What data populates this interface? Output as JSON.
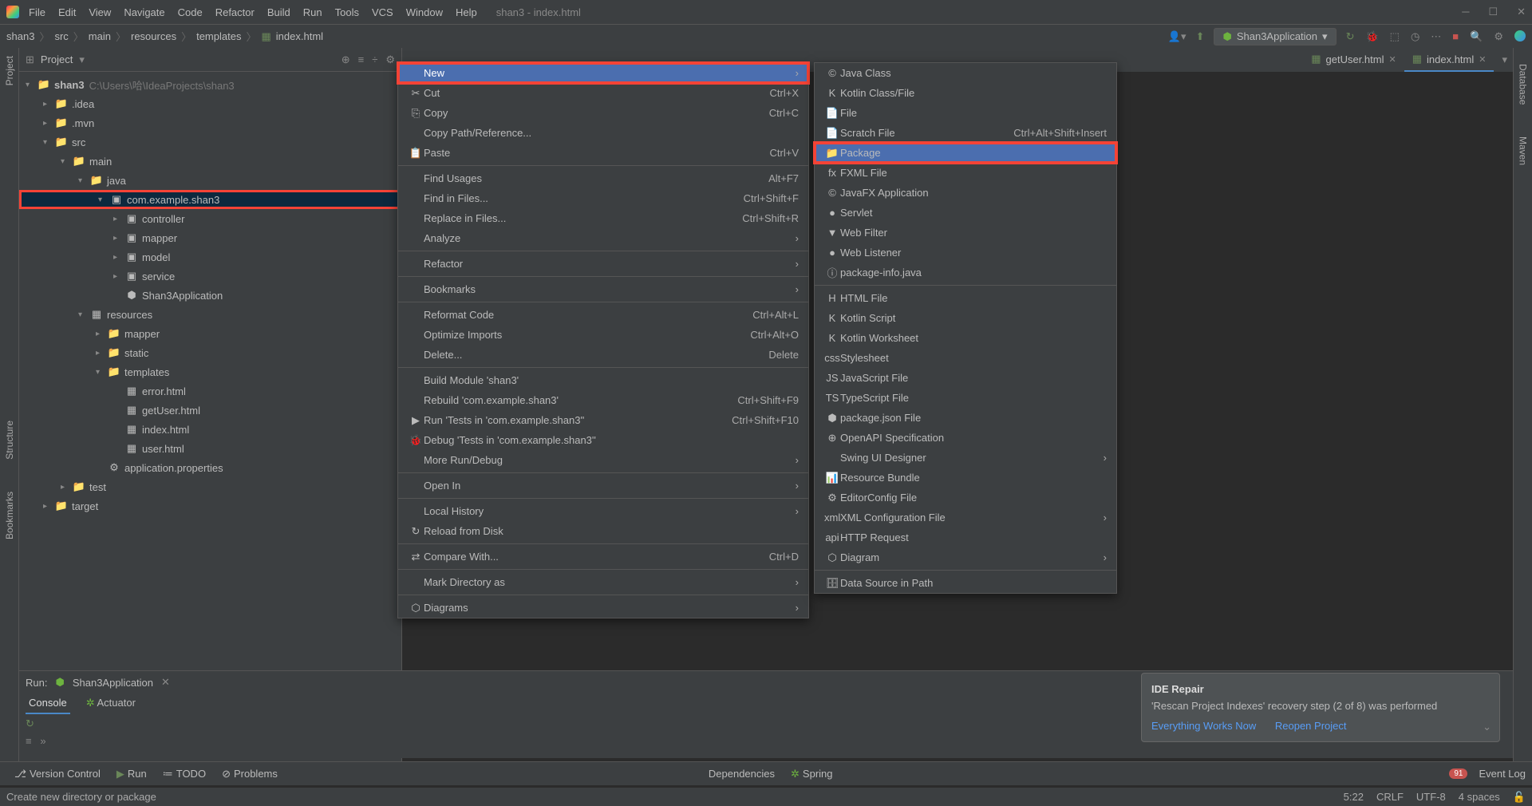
{
  "window": {
    "title": "shan3 - index.html"
  },
  "menubar": [
    "File",
    "Edit",
    "View",
    "Navigate",
    "Code",
    "Refactor",
    "Build",
    "Run",
    "Tools",
    "VCS",
    "Window",
    "Help"
  ],
  "breadcrumb": [
    "shan3",
    "src",
    "main",
    "resources",
    "templates",
    "index.html"
  ],
  "run_config": "Shan3Application",
  "project": {
    "label": "Project",
    "root": {
      "name": "shan3",
      "path": " C:\\Users\\哈\\IdeaProjects\\shan3"
    },
    "tree": [
      {
        "depth": 1,
        "icon": "folder",
        "label": ".idea",
        "arrow": "▸"
      },
      {
        "depth": 1,
        "icon": "folder",
        "label": ".mvn",
        "arrow": "▸"
      },
      {
        "depth": 1,
        "icon": "folder",
        "label": "src",
        "arrow": "▾"
      },
      {
        "depth": 2,
        "icon": "folder",
        "label": "main",
        "arrow": "▾"
      },
      {
        "depth": 3,
        "icon": "folder-blue",
        "label": "java",
        "arrow": "▾"
      },
      {
        "depth": 4,
        "icon": "package",
        "label": "com.example.shan3",
        "arrow": "▾",
        "highlighted": true,
        "selected": true
      },
      {
        "depth": 5,
        "icon": "package",
        "label": "controller",
        "arrow": "▸"
      },
      {
        "depth": 5,
        "icon": "package",
        "label": "mapper",
        "arrow": "▸"
      },
      {
        "depth": 5,
        "icon": "package",
        "label": "model",
        "arrow": "▸"
      },
      {
        "depth": 5,
        "icon": "package",
        "label": "service",
        "arrow": "▸"
      },
      {
        "depth": 5,
        "icon": "spring",
        "label": "Shan3Application",
        "arrow": ""
      },
      {
        "depth": 3,
        "icon": "resources",
        "label": "resources",
        "arrow": "▾"
      },
      {
        "depth": 4,
        "icon": "folder",
        "label": "mapper",
        "arrow": "▸"
      },
      {
        "depth": 4,
        "icon": "folder",
        "label": "static",
        "arrow": "▸"
      },
      {
        "depth": 4,
        "icon": "folder",
        "label": "templates",
        "arrow": "▾"
      },
      {
        "depth": 5,
        "icon": "html",
        "label": "error.html",
        "arrow": ""
      },
      {
        "depth": 5,
        "icon": "html",
        "label": "getUser.html",
        "arrow": ""
      },
      {
        "depth": 5,
        "icon": "html",
        "label": "index.html",
        "arrow": ""
      },
      {
        "depth": 5,
        "icon": "html",
        "label": "user.html",
        "arrow": ""
      },
      {
        "depth": 4,
        "icon": "props",
        "label": "application.properties",
        "arrow": ""
      },
      {
        "depth": 2,
        "icon": "folder",
        "label": "test",
        "arrow": "▸"
      },
      {
        "depth": 1,
        "icon": "folder-orange",
        "label": "target",
        "arrow": "▸"
      }
    ]
  },
  "tabs": [
    {
      "label": "getUser.html",
      "active": false
    },
    {
      "label": "index.html",
      "active": true
    }
  ],
  "context_menu_1": [
    {
      "label": "New",
      "selected": true,
      "highlighted": true,
      "submenu": true
    },
    {
      "icon": "✂",
      "label": "Cut",
      "shortcut": "Ctrl+X"
    },
    {
      "icon": "⎘",
      "label": "Copy",
      "shortcut": "Ctrl+C"
    },
    {
      "label": "Copy Path/Reference..."
    },
    {
      "icon": "📋",
      "label": "Paste",
      "shortcut": "Ctrl+V"
    },
    {
      "sep": true
    },
    {
      "label": "Find Usages",
      "shortcut": "Alt+F7"
    },
    {
      "label": "Find in Files...",
      "shortcut": "Ctrl+Shift+F"
    },
    {
      "label": "Replace in Files...",
      "shortcut": "Ctrl+Shift+R"
    },
    {
      "label": "Analyze",
      "submenu": true
    },
    {
      "sep": true
    },
    {
      "label": "Refactor",
      "submenu": true
    },
    {
      "sep": true
    },
    {
      "label": "Bookmarks",
      "submenu": true
    },
    {
      "sep": true
    },
    {
      "label": "Reformat Code",
      "shortcut": "Ctrl+Alt+L"
    },
    {
      "label": "Optimize Imports",
      "shortcut": "Ctrl+Alt+O"
    },
    {
      "label": "Delete...",
      "shortcut": "Delete"
    },
    {
      "sep": true
    },
    {
      "label": "Build Module 'shan3'"
    },
    {
      "label": "Rebuild 'com.example.shan3'",
      "shortcut": "Ctrl+Shift+F9"
    },
    {
      "icon": "▶",
      "label": "Run 'Tests in 'com.example.shan3''",
      "shortcut": "Ctrl+Shift+F10"
    },
    {
      "icon": "🐞",
      "label": "Debug 'Tests in 'com.example.shan3''"
    },
    {
      "label": "More Run/Debug",
      "submenu": true
    },
    {
      "sep": true
    },
    {
      "label": "Open In",
      "submenu": true
    },
    {
      "sep": true
    },
    {
      "label": "Local History",
      "submenu": true
    },
    {
      "icon": "↻",
      "label": "Reload from Disk"
    },
    {
      "sep": true
    },
    {
      "icon": "⇄",
      "label": "Compare With...",
      "shortcut": "Ctrl+D"
    },
    {
      "sep": true
    },
    {
      "label": "Mark Directory as",
      "submenu": true
    },
    {
      "sep": true
    },
    {
      "icon": "⬡",
      "label": "Diagrams",
      "submenu": true
    }
  ],
  "context_menu_2": [
    {
      "icon": "©",
      "label": "Java Class"
    },
    {
      "icon": "K",
      "label": "Kotlin Class/File"
    },
    {
      "icon": "📄",
      "label": "File"
    },
    {
      "icon": "📄",
      "label": "Scratch File",
      "shortcut": "Ctrl+Alt+Shift+Insert"
    },
    {
      "icon": "📁",
      "label": "Package",
      "highlighted_pkg": true
    },
    {
      "icon": "fx",
      "label": "FXML File"
    },
    {
      "icon": "©",
      "label": "JavaFX Application"
    },
    {
      "icon": "●",
      "label": "Servlet"
    },
    {
      "icon": "▼",
      "label": "Web Filter"
    },
    {
      "icon": "●",
      "label": "Web Listener"
    },
    {
      "icon": "ⓘ",
      "label": "package-info.java"
    },
    {
      "sep": true
    },
    {
      "icon": "H",
      "label": "HTML File"
    },
    {
      "icon": "K",
      "label": "Kotlin Script"
    },
    {
      "icon": "K",
      "label": "Kotlin Worksheet"
    },
    {
      "icon": "css",
      "label": "Stylesheet"
    },
    {
      "icon": "JS",
      "label": "JavaScript File"
    },
    {
      "icon": "TS",
      "label": "TypeScript File"
    },
    {
      "icon": "⬢",
      "label": "package.json File"
    },
    {
      "icon": "⊕",
      "label": "OpenAPI Specification"
    },
    {
      "label": "Swing UI Designer",
      "submenu": true
    },
    {
      "icon": "📊",
      "label": "Resource Bundle"
    },
    {
      "icon": "⚙",
      "label": "EditorConfig File"
    },
    {
      "icon": "xml",
      "label": "XML Configuration File",
      "submenu": true
    },
    {
      "icon": "api",
      "label": "HTTP Request"
    },
    {
      "icon": "⬡",
      "label": "Diagram",
      "submenu": true
    },
    {
      "sep": true
    },
    {
      "icon": "🗄",
      "label": "Data Source in Path"
    }
  ],
  "run_panel": {
    "label": "Run:",
    "config": "Shan3Application",
    "tabs": [
      "Console",
      "Actuator"
    ]
  },
  "notification": {
    "title": "IDE Repair",
    "body": "'Rescan Project Indexes' recovery step (2 of 8) was performed",
    "actions": [
      "Everything Works Now",
      "Reopen Project"
    ]
  },
  "bottom_bar": {
    "buttons": [
      "Version Control",
      "Run",
      "TODO",
      "Problems",
      "Dependencies",
      "Spring"
    ],
    "event_log_count": "91",
    "event_log": "Event Log"
  },
  "statusbar": {
    "hint": "Create new directory or package",
    "line_col": "5:22",
    "sep": "CRLF",
    "enc": "UTF-8",
    "indent": "4 spaces"
  },
  "side_tools_left": [
    "Project",
    "Structure",
    "Bookmarks"
  ],
  "side_tools_right": [
    "Database",
    "Maven"
  ]
}
